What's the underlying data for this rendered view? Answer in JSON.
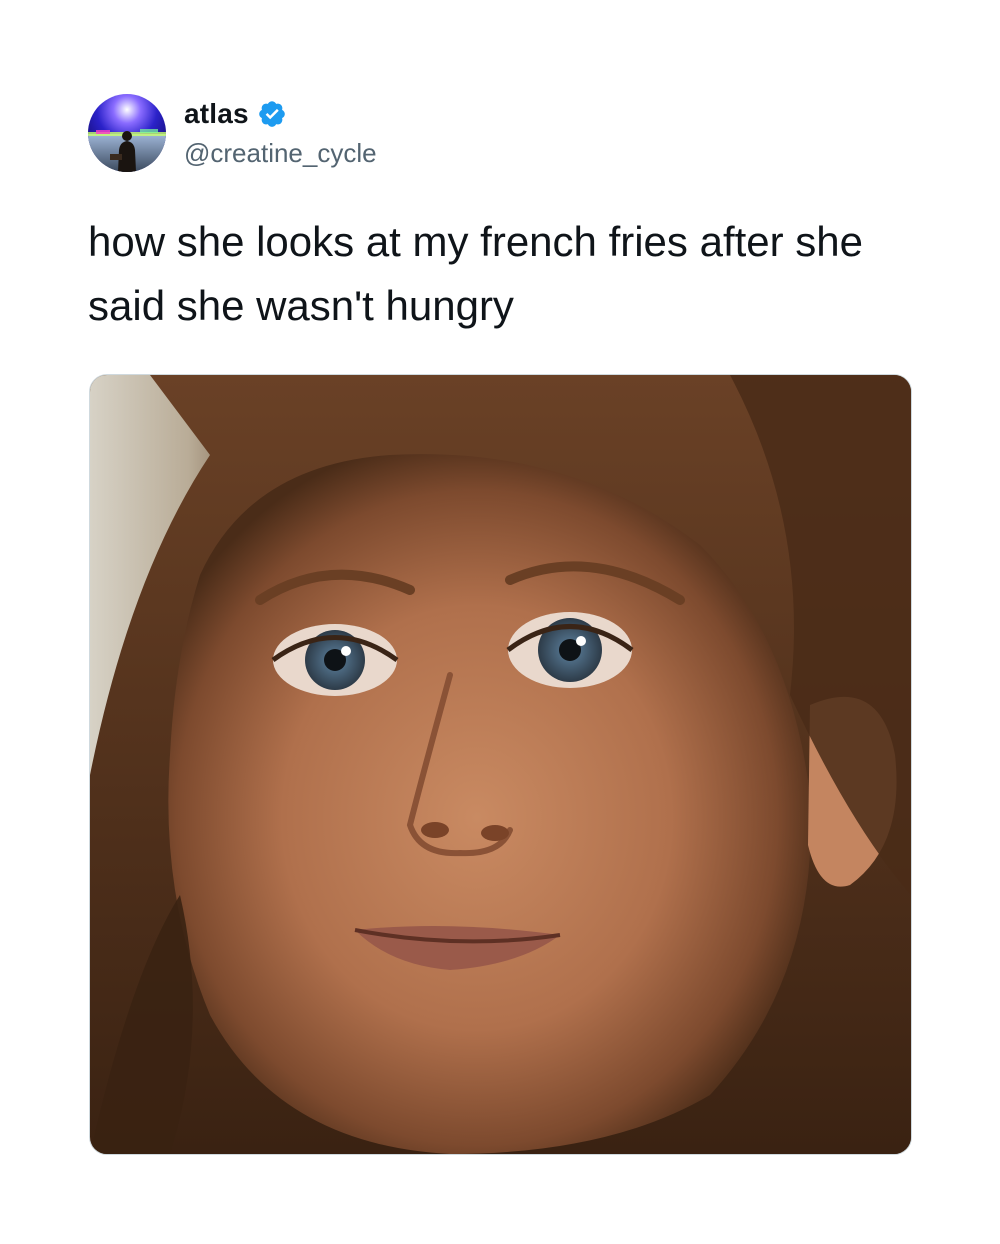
{
  "tweet": {
    "author": {
      "display_name": "atlas",
      "handle": "@creatine_cycle",
      "verified": true,
      "avatar_icon": "avatar-silhouette-night-sky"
    },
    "text": "how she looks at my french fries after she said she wasn't hungry",
    "media": {
      "type": "photo",
      "icon": "photo-woman-closeup"
    }
  },
  "colors": {
    "text_primary": "#0f1419",
    "text_secondary": "#536471",
    "verified_blue": "#1d9bf0",
    "media_border": "#cfd9de"
  }
}
